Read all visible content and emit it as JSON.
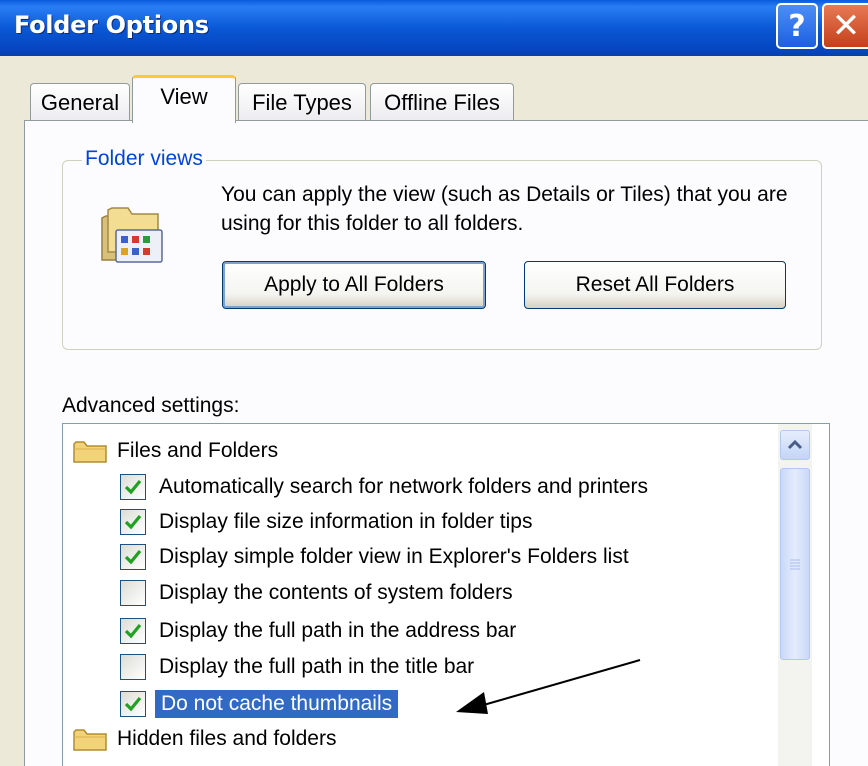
{
  "window": {
    "title": "Folder Options",
    "help_label": "?",
    "close_label": "✕"
  },
  "tabs": [
    {
      "label": "General",
      "active": false
    },
    {
      "label": "View",
      "active": true
    },
    {
      "label": "File Types",
      "active": false
    },
    {
      "label": "Offline Files",
      "active": false
    }
  ],
  "folder_views": {
    "legend": "Folder views",
    "description": "You can apply the view (such as Details or Tiles) that you are using for this folder to all folders.",
    "apply_button": "Apply to All Folders",
    "reset_button": "Reset All Folders",
    "icon": "folder-views-icon"
  },
  "advanced": {
    "label": "Advanced settings:",
    "items": [
      {
        "type": "folder",
        "label": "Files and Folders"
      },
      {
        "type": "checkbox",
        "label": "Automatically search for network folders and printers",
        "checked": true
      },
      {
        "type": "checkbox",
        "label": "Display file size information in folder tips",
        "checked": true
      },
      {
        "type": "checkbox",
        "label": "Display simple folder view in Explorer's Folders list",
        "checked": true
      },
      {
        "type": "checkbox",
        "label": "Display the contents of system folders",
        "checked": false
      },
      {
        "type": "checkbox",
        "label": "Display the full path in the address bar",
        "checked": true
      },
      {
        "type": "checkbox",
        "label": "Display the full path in the title bar",
        "checked": false
      },
      {
        "type": "checkbox",
        "label": "Do not cache thumbnails",
        "checked": true,
        "selected": true
      },
      {
        "type": "folder",
        "label": "Hidden files and folders"
      }
    ]
  },
  "colors": {
    "titlebar": "#0a58d6",
    "selection": "#316ac5",
    "legend_text": "#0046d5",
    "checkmark": "#21a121",
    "active_tab_accent": "#ffc83c"
  }
}
